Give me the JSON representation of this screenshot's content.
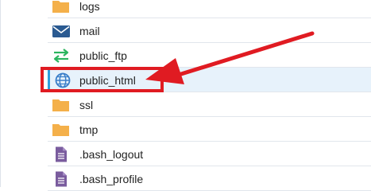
{
  "files": [
    {
      "name": "logs",
      "icon": "folder-icon",
      "selected": false
    },
    {
      "name": "mail",
      "icon": "mail-icon",
      "selected": false
    },
    {
      "name": "public_ftp",
      "icon": "transfer-arrows-icon",
      "selected": false
    },
    {
      "name": "public_html",
      "icon": "globe-icon",
      "selected": true
    },
    {
      "name": "ssl",
      "icon": "folder-icon",
      "selected": false
    },
    {
      "name": "tmp",
      "icon": "folder-icon",
      "selected": false
    },
    {
      "name": ".bash_logout",
      "icon": "file-icon",
      "selected": false
    },
    {
      "name": ".bash_profile",
      "icon": "file-icon",
      "selected": false
    }
  ],
  "colors": {
    "folder": "#f4b04a",
    "mail": "#2a5a91",
    "ftp": "#2bb55f",
    "globe": "#3b7fc9",
    "file": "#7a5c9e",
    "annotation": "#e01b22",
    "selected_bg": "#e7f2fb",
    "selected_border": "#2e9fdd"
  }
}
